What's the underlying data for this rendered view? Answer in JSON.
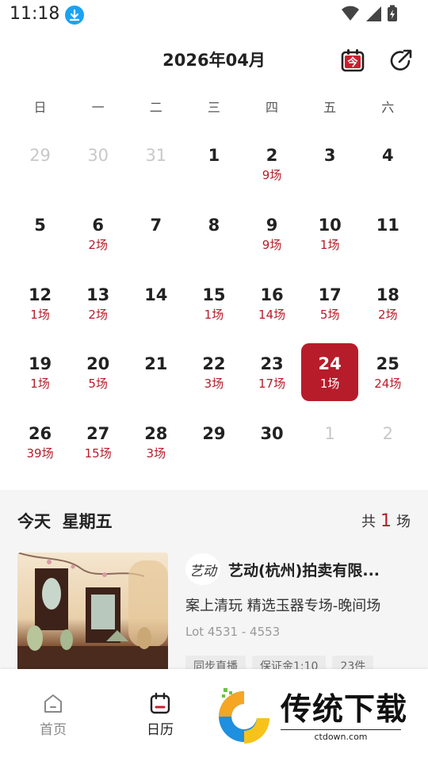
{
  "status_bar": {
    "time": "11:18"
  },
  "header": {
    "month_title": "2026年04月",
    "today_icon_char": "今"
  },
  "weekdays": [
    "日",
    "一",
    "二",
    "三",
    "四",
    "五",
    "六"
  ],
  "calendar": {
    "weeks": [
      [
        {
          "num": "29",
          "count": "",
          "other": true
        },
        {
          "num": "30",
          "count": "",
          "other": true
        },
        {
          "num": "31",
          "count": "",
          "other": true
        },
        {
          "num": "1",
          "count": ""
        },
        {
          "num": "2",
          "count": "9场"
        },
        {
          "num": "3",
          "count": ""
        },
        {
          "num": "4",
          "count": ""
        }
      ],
      [
        {
          "num": "5",
          "count": ""
        },
        {
          "num": "6",
          "count": "2场"
        },
        {
          "num": "7",
          "count": ""
        },
        {
          "num": "8",
          "count": ""
        },
        {
          "num": "9",
          "count": "9场"
        },
        {
          "num": "10",
          "count": "1场"
        },
        {
          "num": "11",
          "count": ""
        }
      ],
      [
        {
          "num": "12",
          "count": "1场"
        },
        {
          "num": "13",
          "count": "2场"
        },
        {
          "num": "14",
          "count": ""
        },
        {
          "num": "15",
          "count": "1场"
        },
        {
          "num": "16",
          "count": "14场"
        },
        {
          "num": "17",
          "count": "5场"
        },
        {
          "num": "18",
          "count": "2场"
        }
      ],
      [
        {
          "num": "19",
          "count": "1场"
        },
        {
          "num": "20",
          "count": "5场"
        },
        {
          "num": "21",
          "count": ""
        },
        {
          "num": "22",
          "count": "3场"
        },
        {
          "num": "23",
          "count": "17场"
        },
        {
          "num": "24",
          "count": "1场",
          "selected": true
        },
        {
          "num": "25",
          "count": "24场"
        }
      ],
      [
        {
          "num": "26",
          "count": "39场"
        },
        {
          "num": "27",
          "count": "15场"
        },
        {
          "num": "28",
          "count": "3场"
        },
        {
          "num": "29",
          "count": ""
        },
        {
          "num": "30",
          "count": ""
        },
        {
          "num": "1",
          "count": "",
          "other": true
        },
        {
          "num": "2",
          "count": "",
          "other": true
        }
      ]
    ]
  },
  "today": {
    "label": "今天  星期五",
    "total_prefix": "共",
    "total_count": "1",
    "total_suffix": "场"
  },
  "auction": {
    "logo_text": "艺动",
    "house_name": "艺动(杭州)拍卖有限...",
    "session_title": "案上清玩 精选玉器专场-晚间场",
    "lot_range": "Lot 4531 - 4553",
    "tags": [
      "同步直播",
      "保证金1:10",
      "23件"
    ]
  },
  "nav": {
    "home_label": "首页",
    "calendar_label": "日历"
  },
  "watermark": {
    "text": "传统下载",
    "url": "ctdown.com"
  },
  "colors": {
    "accent": "#b71c2a",
    "muted_day": "#c8c8c8",
    "section_bg": "#f5f5f5"
  }
}
